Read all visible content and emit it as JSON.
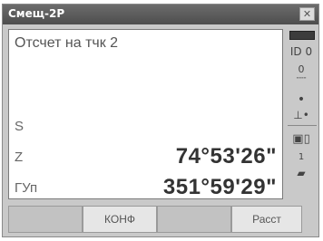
{
  "window": {
    "title": "Смещ-2Р"
  },
  "content": {
    "heading": "Отсчет на тчк 2",
    "rows": [
      {
        "label": "S",
        "value": ""
      },
      {
        "label": "Z",
        "value": "74°53'26\""
      },
      {
        "label": "ГУп",
        "value": "351°59'29\""
      }
    ]
  },
  "status_panel": {
    "icons": [
      "battery-icon",
      "mode-icon",
      "tilt-icon",
      "target-icon",
      "card-icon",
      "page-icon"
    ],
    "mode_text": "ID 0",
    "tilt_text": "0",
    "page_text": "1"
  },
  "softkeys": [
    {
      "label": ""
    },
    {
      "label": "КОНФ"
    },
    {
      "label": ""
    },
    {
      "label": "Расст"
    }
  ],
  "colors": {
    "titlebar": "#555555",
    "panel": "#c9c9c9"
  }
}
